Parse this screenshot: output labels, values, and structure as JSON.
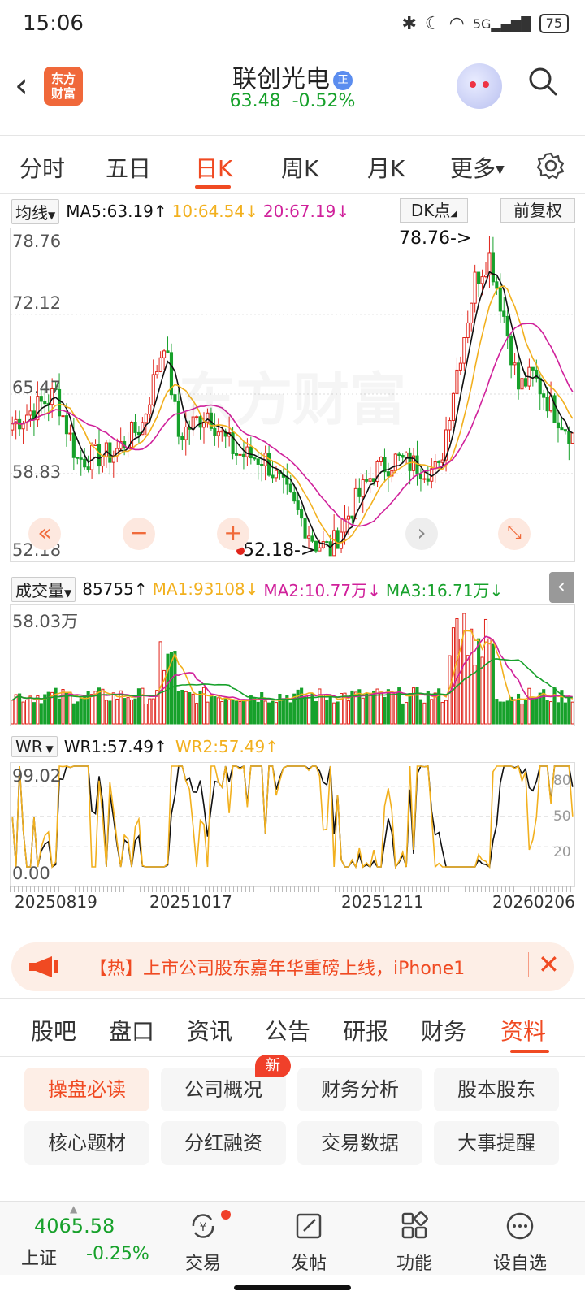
{
  "status": {
    "time": "15:06",
    "battery": "75",
    "signal": "5G"
  },
  "header": {
    "logo_line1": "东方",
    "logo_line2": "财富",
    "stock_name": "联创光电",
    "badge": "正",
    "price": "63.48",
    "change": "-0.52%"
  },
  "tabs": [
    "分时",
    "五日",
    "日K",
    "周K",
    "月K",
    "更多"
  ],
  "ma_row": {
    "type": "均线",
    "ma5": "MA5:63.19",
    "ma10": "10:64.54",
    "ma20": "20:67.19",
    "dk": "DK点",
    "fuquan": "前复权"
  },
  "kline": {
    "y_labels": [
      "78.76",
      "72.12",
      "65.47",
      "58.83",
      "52.18"
    ],
    "high_label": "78.76->",
    "low_label": "52.18->",
    "watermark": "东方财富"
  },
  "volume": {
    "label": "成交量",
    "value": "85755",
    "ma1": "MA1:93108",
    "ma2": "MA2:10.77万",
    "ma3": "MA3:16.71万",
    "max_label": "58.03万"
  },
  "wr": {
    "label": "WR",
    "wr1": "WR1:57.49",
    "wr2": "WR2:57.49",
    "y_top": "99.02",
    "y_bottom": "0.00",
    "r80": "80",
    "r50": "50",
    "r20": "20"
  },
  "dates": [
    "20250819",
    "20251017",
    "20251211",
    "20260206"
  ],
  "news": {
    "text": "【热】上市公司股东嘉年华重磅上线，iPhone1"
  },
  "subtabs": [
    "股吧",
    "盘口",
    "资讯",
    "公告",
    "研报",
    "财务",
    "资料"
  ],
  "grid_buttons": [
    "操盘必读",
    "公司概况",
    "财务分析",
    "股本股东",
    "核心题材",
    "分红融资",
    "交易数据",
    "大事提醒"
  ],
  "new_badge": "新",
  "bottom": {
    "index_value": "4065.58",
    "index_name": "上证",
    "index_change": "-0.25%",
    "items": [
      "交易",
      "发帖",
      "功能",
      "设自选"
    ]
  },
  "colors": {
    "up": "#e0231a",
    "down": "#17a12b",
    "accent": "#f04a22",
    "ma5": "#111111",
    "ma10": "#f2b01e",
    "ma20": "#d0219b"
  }
}
